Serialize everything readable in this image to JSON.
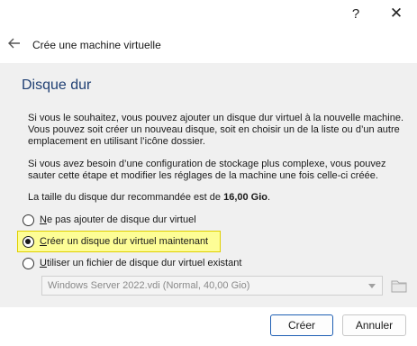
{
  "window": {
    "help_glyph": "?",
    "close_glyph": "✕"
  },
  "header": {
    "title": "Crée une machine virtuelle"
  },
  "page": {
    "title": "Disque dur",
    "para1": "Si vous le souhaitez, vous pouvez ajouter un disque dur virtuel à la nouvelle machine. Vous pouvez soit créer un nouveau disque, soit en choisir un de la liste ou d’un autre emplacement en utilisant l’icône dossier.",
    "para2": "Si vous avez besoin d’une configuration de stockage plus complexe, vous pouvez sauter cette étape et modifier les réglages de la machine une fois celle-ci créée.",
    "recommended_prefix": "La taille du disque dur recommandée est de ",
    "recommended_size": "16,00 Gio",
    "recommended_suffix": "."
  },
  "options": [
    {
      "mnemonic": "N",
      "rest": "e pas ajouter de disque dur virtuel",
      "checked": false
    },
    {
      "mnemonic": "C",
      "rest": "réer un disque dur virtuel maintenant",
      "checked": true
    },
    {
      "mnemonic": "U",
      "rest": "tiliser un fichier de disque dur virtuel existant",
      "checked": false
    }
  ],
  "disk_select": {
    "value": "Windows Server 2022.vdi (Normal, 40,00 Gio)"
  },
  "buttons": {
    "create": "Créer",
    "cancel": "Annuler"
  },
  "icons": {
    "back": "back-arrow-icon",
    "folder": "folder-icon",
    "help": "help-icon",
    "close": "close-icon"
  },
  "colors": {
    "section_title": "#1f3f73",
    "highlight": "#fdfd96",
    "default_button_border": "#1f5fb4"
  }
}
